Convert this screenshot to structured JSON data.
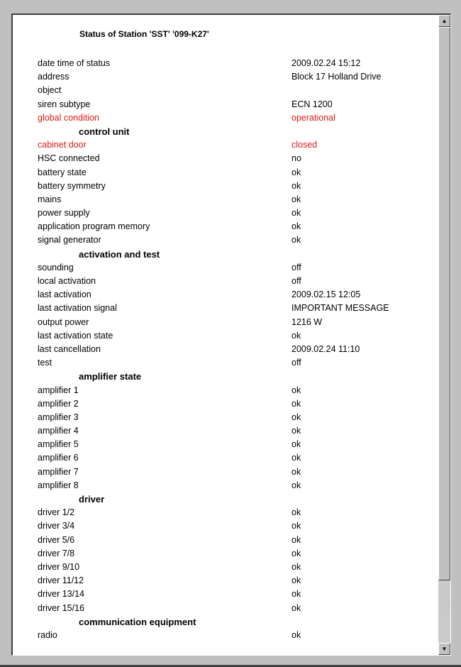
{
  "title": "Status of Station 'SST' '099-K27'",
  "colors": {
    "alert": "#e01818",
    "normal": "#000000"
  },
  "rows": [
    {
      "label": "date time of status",
      "value": "2009.02.24  15:12",
      "type": "item"
    },
    {
      "label": "address",
      "value": "Block 17 Holland Drive",
      "type": "item"
    },
    {
      "label": "object",
      "value": "",
      "type": "item"
    },
    {
      "label": "siren subtype",
      "value": "ECN 1200",
      "type": "item"
    },
    {
      "label": "global condition",
      "value": "operational",
      "type": "alert"
    },
    {
      "label": "control unit",
      "value": "",
      "type": "section"
    },
    {
      "label": "cabinet door",
      "value": "closed",
      "type": "alert"
    },
    {
      "label": "HSC connected",
      "value": "no",
      "type": "item"
    },
    {
      "label": "battery state",
      "value": "ok",
      "type": "item"
    },
    {
      "label": "battery symmetry",
      "value": "ok",
      "type": "item"
    },
    {
      "label": "mains",
      "value": "ok",
      "type": "item"
    },
    {
      "label": "power supply",
      "value": "ok",
      "type": "item"
    },
    {
      "label": "application program memory",
      "value": "ok",
      "type": "item"
    },
    {
      "label": "signal generator",
      "value": "ok",
      "type": "item"
    },
    {
      "label": "activation and test",
      "value": "",
      "type": "section"
    },
    {
      "label": "sounding",
      "value": "off",
      "type": "item"
    },
    {
      "label": "local activation",
      "value": "off",
      "type": "item"
    },
    {
      "label": "last activation",
      "value": "2009.02.15  12:05",
      "type": "item"
    },
    {
      "label": "last activation signal",
      "value": "IMPORTANT MESSAGE",
      "type": "item"
    },
    {
      "label": "output power",
      "value": "1216  W",
      "type": "item"
    },
    {
      "label": "last activation state",
      "value": "ok",
      "type": "item"
    },
    {
      "label": "last cancellation",
      "value": "2009.02.24  11:10",
      "type": "item"
    },
    {
      "label": "test",
      "value": "off",
      "type": "item"
    },
    {
      "label": "amplifier state",
      "value": "",
      "type": "section"
    },
    {
      "label": "amplifier 1",
      "value": "ok",
      "type": "item"
    },
    {
      "label": "amplifier 2",
      "value": "ok",
      "type": "item"
    },
    {
      "label": "amplifier 3",
      "value": "ok",
      "type": "item"
    },
    {
      "label": "amplifier 4",
      "value": "ok",
      "type": "item"
    },
    {
      "label": "amplifier 5",
      "value": "ok",
      "type": "item"
    },
    {
      "label": "amplifier 6",
      "value": "ok",
      "type": "item"
    },
    {
      "label": "amplifier 7",
      "value": "ok",
      "type": "item"
    },
    {
      "label": "amplifier 8",
      "value": "ok",
      "type": "item"
    },
    {
      "label": "driver",
      "value": "",
      "type": "section"
    },
    {
      "label": "driver 1/2",
      "value": "ok",
      "type": "item"
    },
    {
      "label": "driver 3/4",
      "value": "ok",
      "type": "item"
    },
    {
      "label": "driver 5/6",
      "value": "ok",
      "type": "item"
    },
    {
      "label": "driver 7/8",
      "value": "ok",
      "type": "item"
    },
    {
      "label": "driver 9/10",
      "value": "ok",
      "type": "item"
    },
    {
      "label": "driver 11/12",
      "value": "ok",
      "type": "item"
    },
    {
      "label": "driver 13/14",
      "value": "ok",
      "type": "item"
    },
    {
      "label": "driver 15/16",
      "value": "ok",
      "type": "item"
    },
    {
      "label": "communication equipment",
      "value": "",
      "type": "section"
    },
    {
      "label": "radio",
      "value": "ok",
      "type": "item"
    }
  ],
  "scrollbar": {
    "up_icon": "▲",
    "down_icon": "▼"
  }
}
